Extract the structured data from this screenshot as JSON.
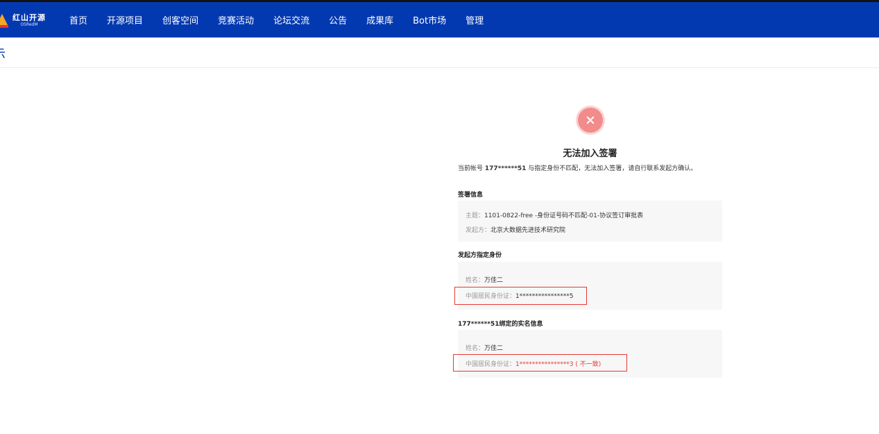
{
  "brand": {
    "name_cn": "红山开源",
    "name_en": "OSRedM"
  },
  "nav": [
    "首页",
    "开源项目",
    "创客空间",
    "竞赛活动",
    "论坛交流",
    "公告",
    "成果库",
    "Bot市场",
    "管理"
  ],
  "subbar": {
    "title_fragment": "示"
  },
  "result": {
    "title": "无法加入签署",
    "desc_prefix": "当前帐号 ",
    "desc_account": "177******51",
    "desc_suffix": " 与指定身份不匹配，无法加入签署，请自行联系发起方确认。"
  },
  "sign_info": {
    "heading": "签署信息",
    "subject_label": "主题：",
    "subject_value": "1101-0822-free -身份证号码不匹配-01-协议签订审批表",
    "initiator_label": "发起方：",
    "initiator_value": "北京大数据先进技术研究院"
  },
  "designated": {
    "heading": "发起方指定身份",
    "name_label": "姓名：",
    "name_value": "万佳二",
    "id_label": "中国居民身份证：",
    "id_value": "1****************5"
  },
  "bound": {
    "heading": "177******51绑定的实名信息",
    "name_label": "姓名：",
    "name_value": "万佳二",
    "id_label": "中国居民身份证：",
    "id_value": "1****************3 ( 不一致)"
  },
  "colors": {
    "nav_bg": "#0339b0",
    "error": "#e53935",
    "error_icon": "#f28b8b"
  },
  "icons": {
    "error": "close-circle-icon",
    "logo": "mountain-logo-icon"
  }
}
